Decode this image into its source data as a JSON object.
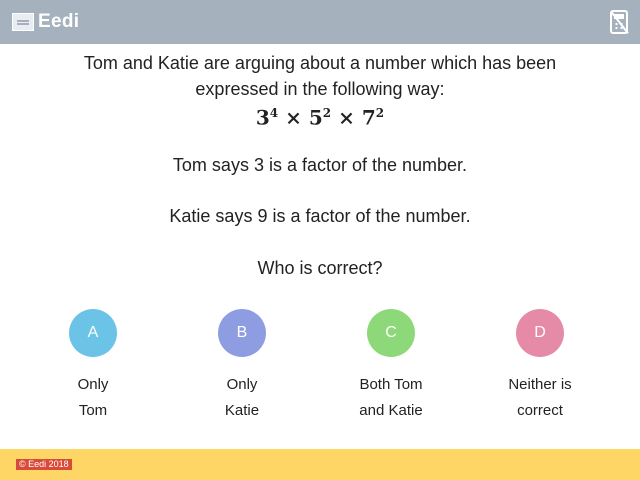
{
  "header": {
    "brand": "Eedi",
    "calculator_icon": "calculator-disabled-icon"
  },
  "question": {
    "line1": "Tom and Katie are arguing about a number which has been",
    "line2": "expressed in the following way:",
    "formula": {
      "b1": "3",
      "e1": "4",
      "op1": "×",
      "b2": "5",
      "e2": "2",
      "op2": "×",
      "b3": "7",
      "e3": "2"
    },
    "tom_statement": "Tom says 3 is a factor of the number.",
    "katie_statement": "Katie says 9 is a factor of the number.",
    "prompt": "Who is correct?"
  },
  "options": [
    {
      "letter": "A",
      "line1": "Only",
      "line2": "Tom",
      "color": "#6bc4e8"
    },
    {
      "letter": "B",
      "line1": "Only",
      "line2": "Katie",
      "color": "#8e9de1"
    },
    {
      "letter": "C",
      "line1": "Both Tom",
      "line2": "and Katie",
      "color": "#8dd97a"
    },
    {
      "letter": "D",
      "line1": "Neither is",
      "line2": "correct",
      "color": "#e58ba7"
    }
  ],
  "footer": {
    "copyright": "© Eedi 2018"
  }
}
